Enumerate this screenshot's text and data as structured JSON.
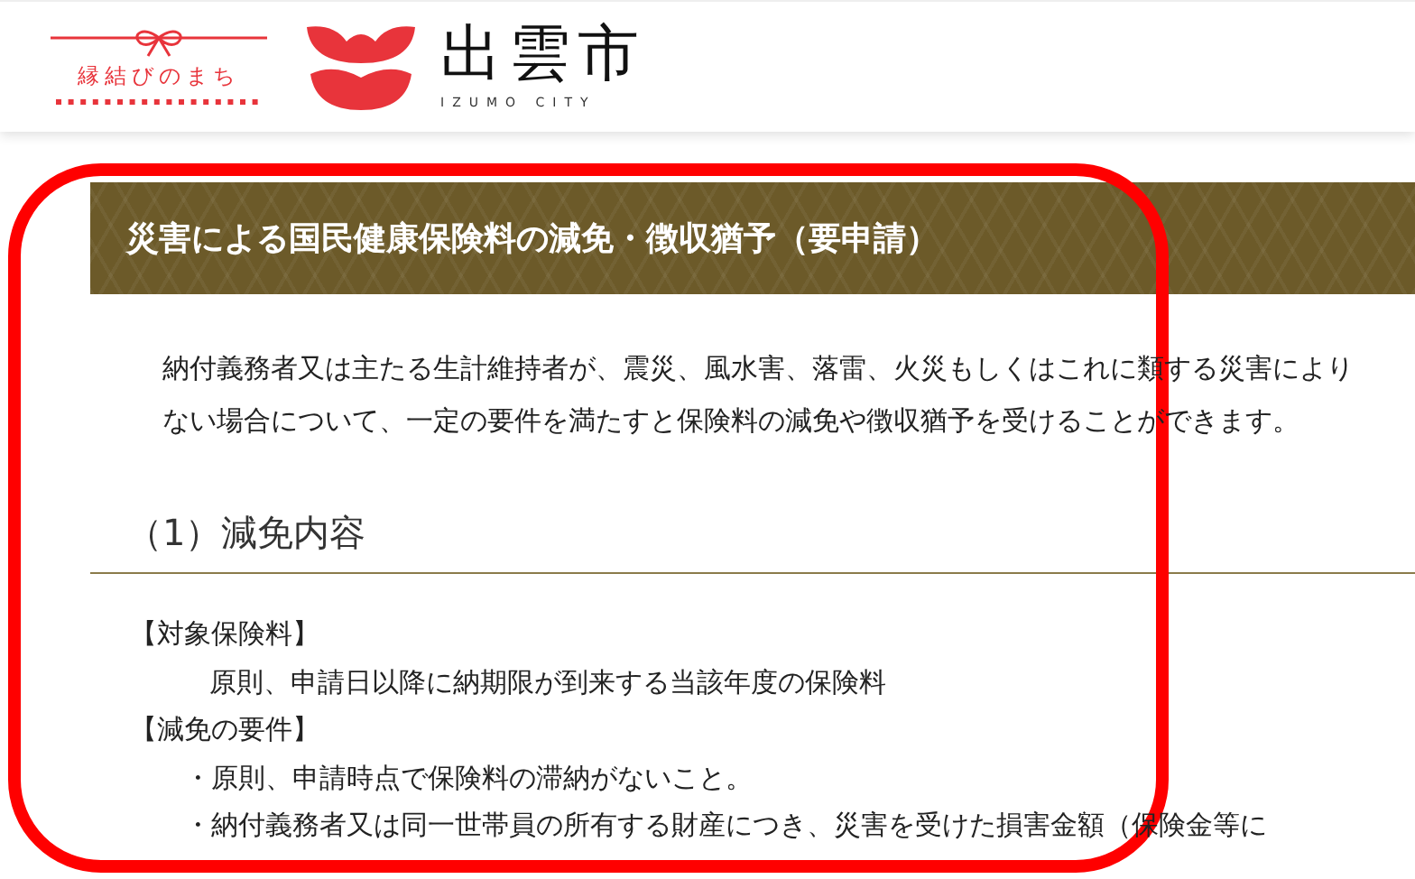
{
  "header": {
    "tagline": "縁結びのまち",
    "city_name": "出雲市",
    "city_name_en": "IZUMO CITY"
  },
  "page_title": "災害による国民健康保険料の減免・徴収猶予（要申請）",
  "intro": [
    "納付義務者又は主たる生計維持者が、震災、風水害、落雷、火災もしくはこれに類する災害により",
    "ない場合について、一定の要件を満たすと保険料の減免や徴収猶予を受けることができます。"
  ],
  "section_heading": "（1）減免内容",
  "items": [
    {
      "kind": "label",
      "text": "【対象保険料】"
    },
    {
      "kind": "indent",
      "text": "原則、申請日以降に納期限が到来する当該年度の保険料"
    },
    {
      "kind": "label",
      "text": "【減免の要件】"
    },
    {
      "kind": "bullet",
      "text": "・原則、申請時点で保険料の滞納がないこと。"
    },
    {
      "kind": "bullet",
      "text": "・納付義務者又は同一世帯員の所有する財産につき、災害を受けた損害金額（保険金等に"
    }
  ],
  "annotation": {
    "kind": "highlight-frame",
    "color": "#ff0000"
  }
}
